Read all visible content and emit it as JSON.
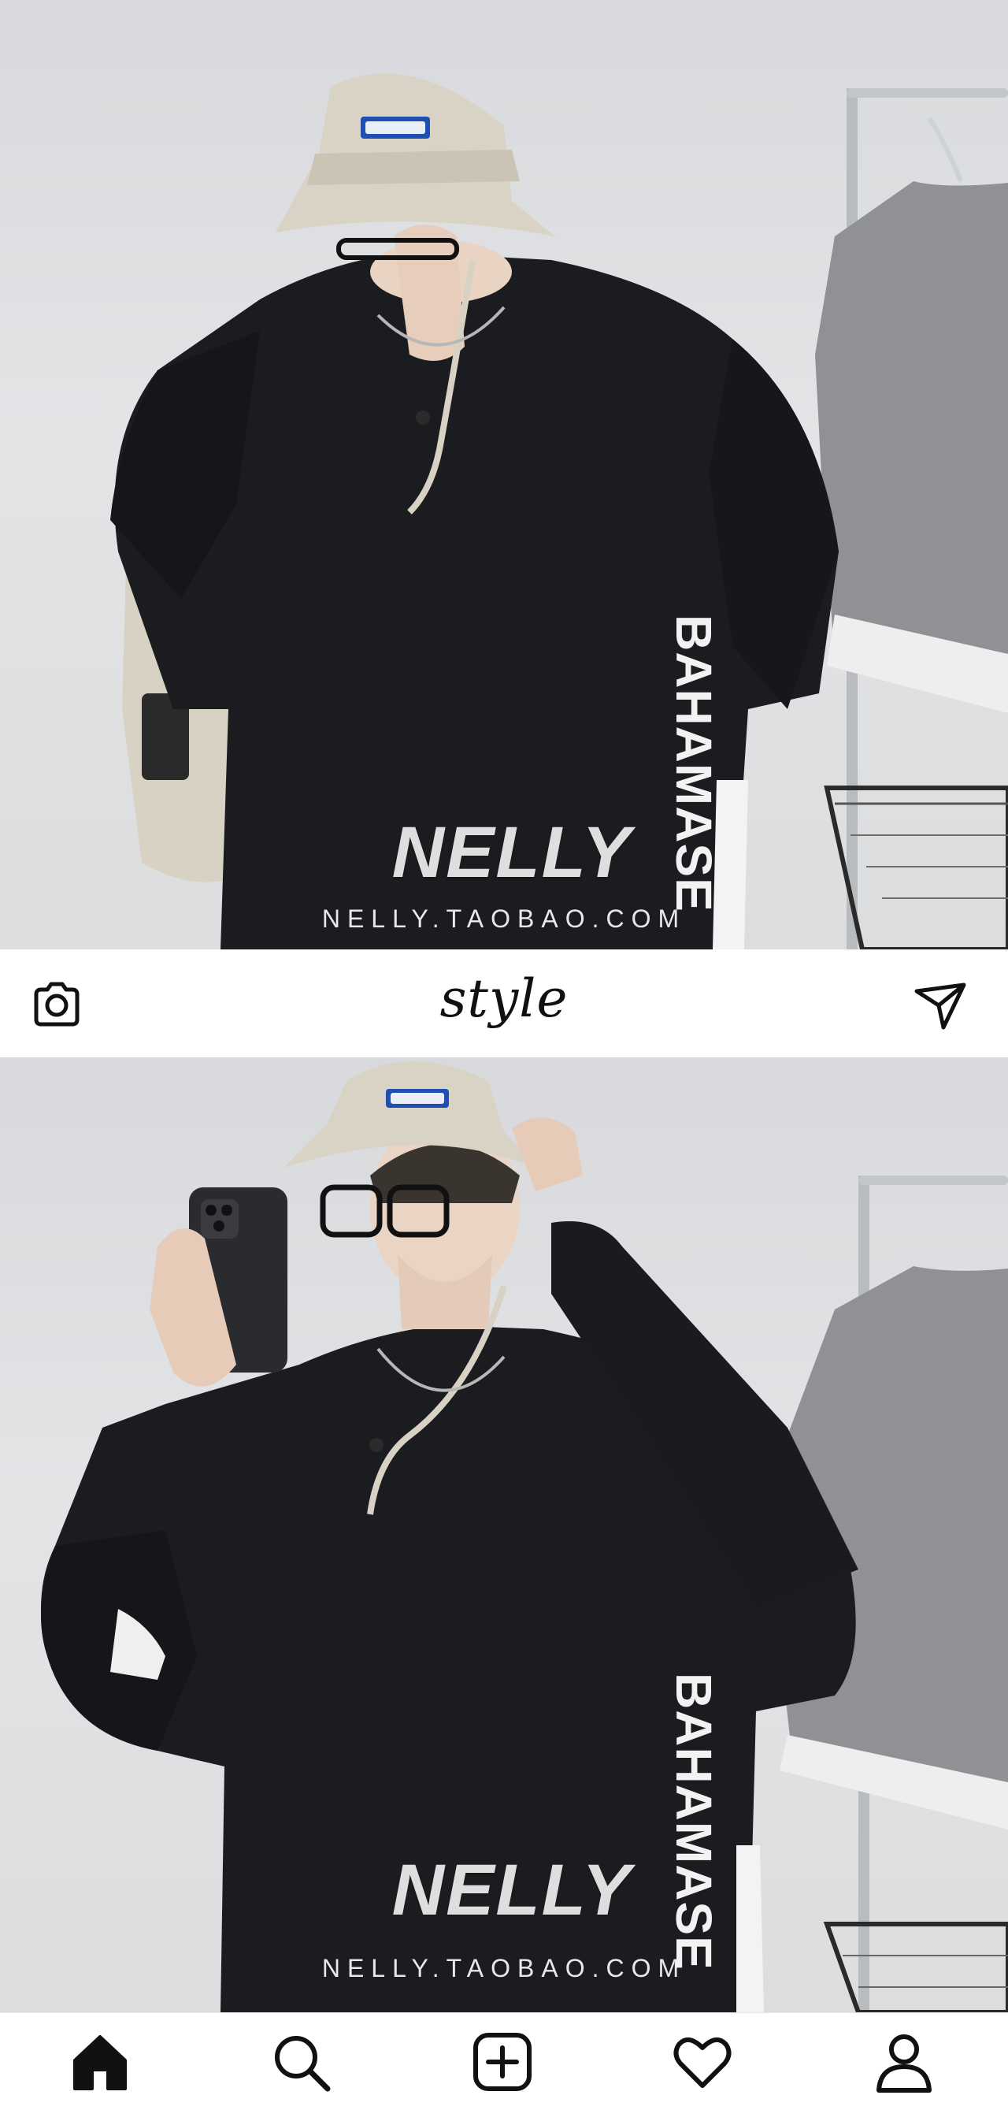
{
  "app": {
    "title": "style"
  },
  "header": {
    "left_icon": "camera-icon",
    "right_icon": "send-icon"
  },
  "posts": [
    {
      "watermark_logo": "NELLY",
      "watermark_url": "NELLY.TAOBAO.COM",
      "shirt_print": "BAHAMASE"
    },
    {
      "watermark_logo": "NELLY",
      "watermark_url": "NELLY.TAOBAO.COM",
      "shirt_print": "BAHAMASE"
    }
  ],
  "nav": {
    "items": [
      {
        "icon": "home-icon",
        "active": true
      },
      {
        "icon": "search-icon",
        "active": false
      },
      {
        "icon": "add-post-icon",
        "active": false
      },
      {
        "icon": "heart-icon",
        "active": false
      },
      {
        "icon": "profile-icon",
        "active": false
      }
    ]
  },
  "colors": {
    "background": "#ffffff",
    "icon": "#111111",
    "sweatshirt": "#1b1c1f",
    "hat": "#d8d2c4",
    "wall": "#dcdee0"
  }
}
